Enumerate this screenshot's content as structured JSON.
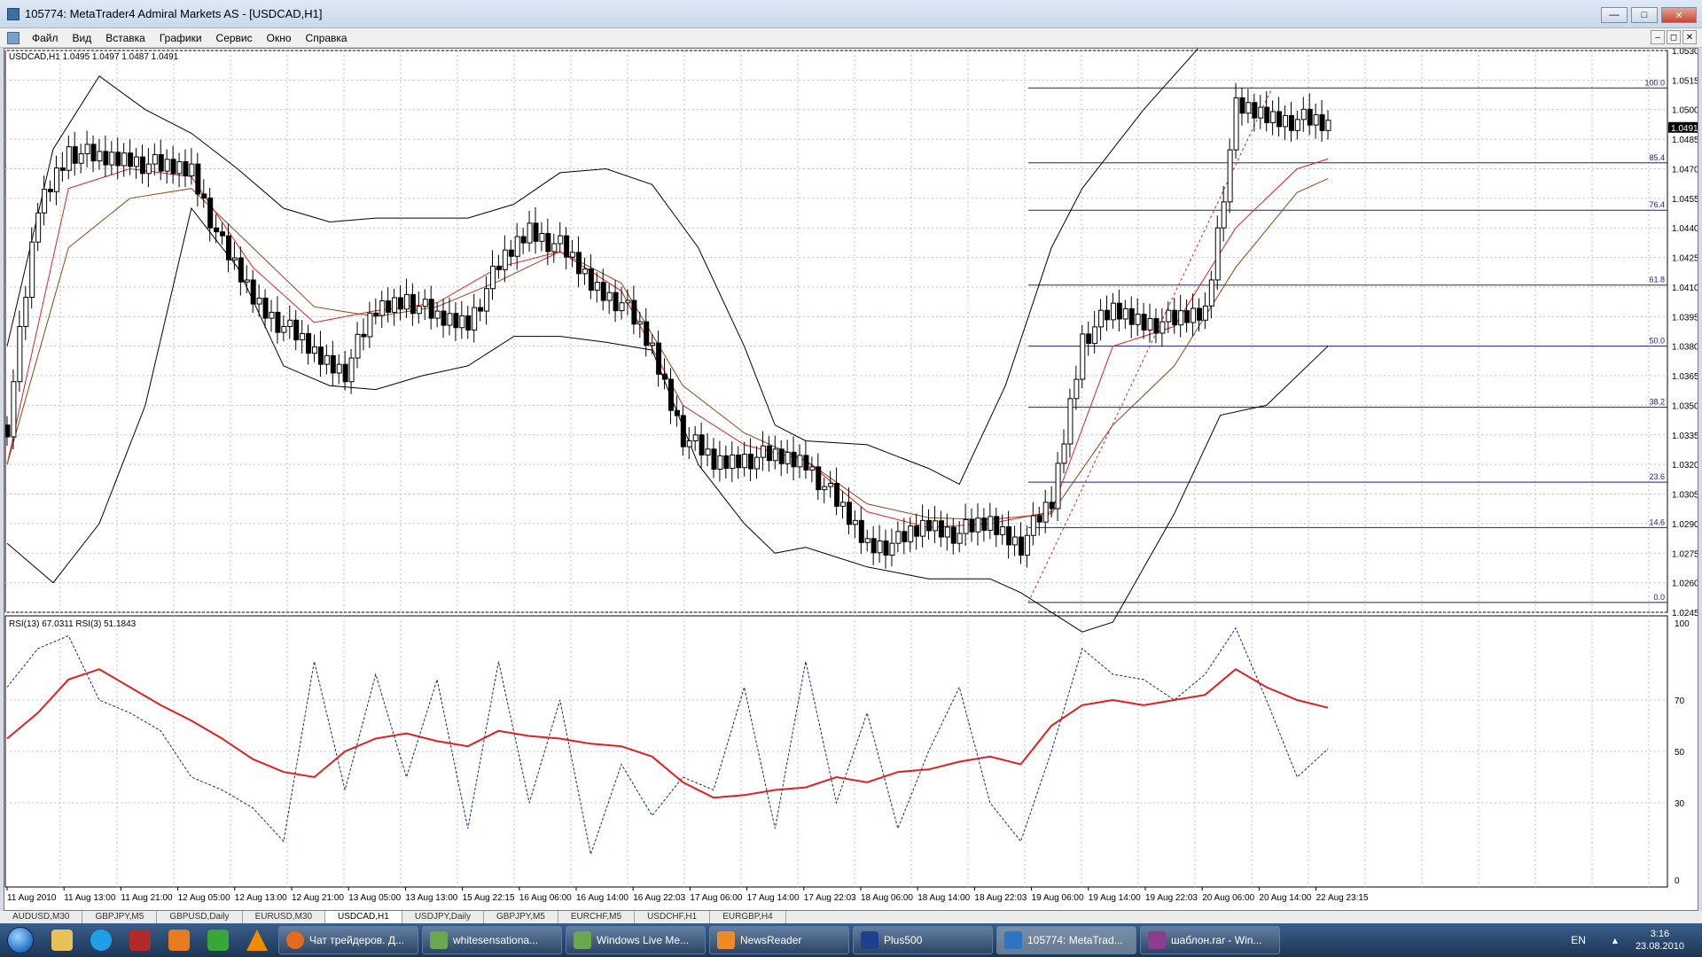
{
  "window": {
    "title": "105774: MetaTrader4 Admiral Markets AS - [USDCAD,H1]",
    "min_label": "—",
    "max_label": "□",
    "close_label": "✕"
  },
  "menu": {
    "items": [
      "Файл",
      "Вид",
      "Вставка",
      "Графики",
      "Сервис",
      "Окно",
      "Справка"
    ],
    "mdi": [
      "–",
      "◻",
      "✕"
    ]
  },
  "chart": {
    "header": "USDCAD,H1  1.0495 1.0497 1.0487 1.0491",
    "price_axis": [
      "1.0530",
      "1.0515",
      "1.0500",
      "1.0485",
      "1.0470",
      "1.0455",
      "1.0440",
      "1.0425",
      "1.0410",
      "1.0395",
      "1.0380",
      "1.0365",
      "1.0350",
      "1.0335",
      "1.0320",
      "1.0305",
      "1.0290",
      "1.0275",
      "1.0260",
      "1.0245"
    ],
    "current_price": "1.0491",
    "fib_levels": [
      {
        "label": "100.0",
        "price": 1.0511
      },
      {
        "label": "85.4",
        "price": 1.0473
      },
      {
        "label": "76.4",
        "price": 1.0449
      },
      {
        "label": "61.8",
        "price": 1.0411
      },
      {
        "label": "50.0",
        "price": 1.038
      },
      {
        "label": "38.2",
        "price": 1.0349
      },
      {
        "label": "23.6",
        "price": 1.0311
      },
      {
        "label": "14.6",
        "price": 1.0288
      },
      {
        "label": "0.0",
        "price": 1.025
      }
    ],
    "time_axis": [
      "11 Aug 2010",
      "11 Aug 13:00",
      "11 Aug 21:00",
      "12 Aug 05:00",
      "12 Aug 13:00",
      "12 Aug 21:00",
      "13 Aug 05:00",
      "13 Aug 13:00",
      "15 Aug 22:15",
      "16 Aug 06:00",
      "16 Aug 14:00",
      "16 Aug 22:03",
      "17 Aug 06:00",
      "17 Aug 14:00",
      "17 Aug 22:03",
      "18 Aug 06:00",
      "18 Aug 14:00",
      "18 Aug 22:03",
      "19 Aug 06:00",
      "19 Aug 14:00",
      "19 Aug 22:03",
      "20 Aug 06:00",
      "20 Aug 14:00",
      "22 Aug 23:15"
    ],
    "rsi_header": "RSI(13) 67.0311  RSI(3) 51.1843",
    "rsi_axis": [
      "100",
      "70",
      "50",
      "30",
      "0"
    ]
  },
  "chart_data": {
    "type": "line",
    "symbol": "USDCAD",
    "timeframe": "H1",
    "ylim": [
      1.0245,
      1.053
    ],
    "close_path": [
      [
        0,
        1.034
      ],
      [
        20,
        1.045
      ],
      [
        40,
        1.048
      ],
      [
        60,
        1.0474
      ],
      [
        80,
        1.0476
      ],
      [
        100,
        1.047
      ],
      [
        120,
        1.047
      ],
      [
        140,
        1.043
      ],
      [
        160,
        1.0405
      ],
      [
        180,
        1.039
      ],
      [
        200,
        1.0376
      ],
      [
        220,
        1.0368
      ],
      [
        240,
        1.0398
      ],
      [
        260,
        1.0405
      ],
      [
        280,
        1.0393
      ],
      [
        300,
        1.0393
      ],
      [
        320,
        1.042
      ],
      [
        340,
        1.044
      ],
      [
        360,
        1.043
      ],
      [
        380,
        1.0412
      ],
      [
        400,
        1.0402
      ],
      [
        420,
        1.0378
      ],
      [
        440,
        1.0335
      ],
      [
        460,
        1.032
      ],
      [
        480,
        1.0324
      ],
      [
        500,
        1.0323
      ],
      [
        520,
        1.0322
      ],
      [
        540,
        1.03
      ],
      [
        560,
        1.028
      ],
      [
        580,
        1.028
      ],
      [
        600,
        1.029
      ],
      [
        620,
        1.0285
      ],
      [
        640,
        1.029
      ],
      [
        660,
        1.028
      ],
      [
        680,
        1.03
      ],
      [
        700,
        1.0385
      ],
      [
        720,
        1.0397
      ],
      [
        740,
        1.0393
      ],
      [
        760,
        1.0392
      ],
      [
        780,
        1.0398
      ],
      [
        800,
        1.05
      ],
      [
        820,
        1.0497
      ],
      [
        840,
        1.0495
      ],
      [
        860,
        1.0491
      ]
    ],
    "ema_fast": [
      [
        0,
        1.032
      ],
      [
        40,
        1.046
      ],
      [
        80,
        1.047
      ],
      [
        120,
        1.0466
      ],
      [
        160,
        1.042
      ],
      [
        200,
        1.0392
      ],
      [
        240,
        1.0398
      ],
      [
        280,
        1.0402
      ],
      [
        320,
        1.042
      ],
      [
        360,
        1.0428
      ],
      [
        400,
        1.0408
      ],
      [
        440,
        1.035
      ],
      [
        480,
        1.033
      ],
      [
        520,
        1.0322
      ],
      [
        560,
        1.0296
      ],
      [
        600,
        1.0288
      ],
      [
        640,
        1.029
      ],
      [
        680,
        1.0296
      ],
      [
        720,
        1.038
      ],
      [
        760,
        1.039
      ],
      [
        800,
        1.044
      ],
      [
        840,
        1.047
      ],
      [
        860,
        1.0475
      ]
    ],
    "ema_slow": [
      [
        0,
        1.032
      ],
      [
        40,
        1.043
      ],
      [
        80,
        1.0455
      ],
      [
        120,
        1.046
      ],
      [
        160,
        1.043
      ],
      [
        200,
        1.04
      ],
      [
        240,
        1.0395
      ],
      [
        280,
        1.04
      ],
      [
        320,
        1.0413
      ],
      [
        360,
        1.0428
      ],
      [
        400,
        1.0412
      ],
      [
        440,
        1.036
      ],
      [
        480,
        1.0336
      ],
      [
        520,
        1.0322
      ],
      [
        560,
        1.03
      ],
      [
        600,
        1.0293
      ],
      [
        640,
        1.0292
      ],
      [
        680,
        1.0295
      ],
      [
        720,
        1.034
      ],
      [
        760,
        1.037
      ],
      [
        800,
        1.042
      ],
      [
        840,
        1.0458
      ],
      [
        860,
        1.0465
      ]
    ],
    "bb_upper": [
      [
        0,
        1.038
      ],
      [
        30,
        1.048
      ],
      [
        60,
        1.0517
      ],
      [
        90,
        1.05
      ],
      [
        120,
        1.0488
      ],
      [
        150,
        1.047
      ],
      [
        180,
        1.045
      ],
      [
        210,
        1.0443
      ],
      [
        240,
        1.0445
      ],
      [
        270,
        1.0445
      ],
      [
        300,
        1.0445
      ],
      [
        330,
        1.0452
      ],
      [
        360,
        1.0468
      ],
      [
        390,
        1.047
      ],
      [
        420,
        1.0462
      ],
      [
        450,
        1.043
      ],
      [
        480,
        1.038
      ],
      [
        500,
        1.034
      ],
      [
        520,
        1.0332
      ],
      [
        560,
        1.033
      ],
      [
        600,
        1.0318
      ],
      [
        620,
        1.031
      ],
      [
        650,
        1.036
      ],
      [
        680,
        1.043
      ],
      [
        700,
        1.046
      ],
      [
        740,
        1.05
      ],
      [
        780,
        1.0535
      ]
    ],
    "bb_lower": [
      [
        0,
        1.028
      ],
      [
        30,
        1.026
      ],
      [
        60,
        1.029
      ],
      [
        90,
        1.035
      ],
      [
        120,
        1.045
      ],
      [
        150,
        1.042
      ],
      [
        180,
        1.037
      ],
      [
        210,
        1.036
      ],
      [
        240,
        1.0358
      ],
      [
        270,
        1.0365
      ],
      [
        300,
        1.037
      ],
      [
        330,
        1.0385
      ],
      [
        360,
        1.0385
      ],
      [
        390,
        1.0382
      ],
      [
        420,
        1.0378
      ],
      [
        450,
        1.032
      ],
      [
        480,
        1.029
      ],
      [
        500,
        1.0275
      ],
      [
        520,
        1.0278
      ],
      [
        560,
        1.0268
      ],
      [
        600,
        1.0262
      ],
      [
        640,
        1.0262
      ],
      [
        660,
        1.0255
      ],
      [
        700,
        1.0235
      ],
      [
        720,
        1.024
      ],
      [
        760,
        1.0295
      ],
      [
        790,
        1.0345
      ],
      [
        820,
        1.035
      ],
      [
        860,
        1.038
      ]
    ],
    "rsi13": [
      [
        0,
        55
      ],
      [
        20,
        65
      ],
      [
        40,
        78
      ],
      [
        60,
        82
      ],
      [
        80,
        75
      ],
      [
        100,
        68
      ],
      [
        120,
        62
      ],
      [
        140,
        55
      ],
      [
        160,
        47
      ],
      [
        180,
        42
      ],
      [
        200,
        40
      ],
      [
        220,
        50
      ],
      [
        240,
        55
      ],
      [
        260,
        57
      ],
      [
        280,
        54
      ],
      [
        300,
        52
      ],
      [
        320,
        58
      ],
      [
        340,
        56
      ],
      [
        360,
        55
      ],
      [
        380,
        53
      ],
      [
        400,
        52
      ],
      [
        420,
        48
      ],
      [
        440,
        38
      ],
      [
        460,
        32
      ],
      [
        480,
        33
      ],
      [
        500,
        35
      ],
      [
        520,
        36
      ],
      [
        540,
        40
      ],
      [
        560,
        38
      ],
      [
        580,
        42
      ],
      [
        600,
        43
      ],
      [
        620,
        46
      ],
      [
        640,
        48
      ],
      [
        660,
        45
      ],
      [
        680,
        60
      ],
      [
        700,
        68
      ],
      [
        720,
        70
      ],
      [
        740,
        68
      ],
      [
        760,
        70
      ],
      [
        780,
        72
      ],
      [
        800,
        82
      ],
      [
        820,
        75
      ],
      [
        840,
        70
      ],
      [
        860,
        67
      ]
    ],
    "rsi3": [
      [
        0,
        75
      ],
      [
        20,
        90
      ],
      [
        40,
        95
      ],
      [
        60,
        70
      ],
      [
        80,
        65
      ],
      [
        100,
        58
      ],
      [
        120,
        40
      ],
      [
        140,
        35
      ],
      [
        160,
        28
      ],
      [
        180,
        15
      ],
      [
        200,
        85
      ],
      [
        220,
        35
      ],
      [
        240,
        80
      ],
      [
        260,
        40
      ],
      [
        280,
        78
      ],
      [
        300,
        20
      ],
      [
        320,
        85
      ],
      [
        340,
        30
      ],
      [
        360,
        70
      ],
      [
        380,
        10
      ],
      [
        400,
        45
      ],
      [
        420,
        25
      ],
      [
        440,
        40
      ],
      [
        460,
        35
      ],
      [
        480,
        75
      ],
      [
        500,
        20
      ],
      [
        520,
        85
      ],
      [
        540,
        30
      ],
      [
        560,
        65
      ],
      [
        580,
        20
      ],
      [
        600,
        50
      ],
      [
        620,
        75
      ],
      [
        640,
        30
      ],
      [
        660,
        15
      ],
      [
        680,
        50
      ],
      [
        700,
        90
      ],
      [
        720,
        80
      ],
      [
        740,
        78
      ],
      [
        760,
        70
      ],
      [
        780,
        80
      ],
      [
        800,
        98
      ],
      [
        820,
        70
      ],
      [
        840,
        40
      ],
      [
        860,
        51
      ]
    ],
    "rsi_ylim": [
      0,
      100
    ]
  },
  "symbol_tabs": [
    "AUDUSD,M30",
    "GBPJPY,M5",
    "GBPUSD,Daily",
    "EURUSD,M30",
    "USDCAD,H1",
    "USDJPY,Daily",
    "GBPJPY,M5",
    "EURCHF,M5",
    "USDCHF,H1",
    "EURGBP,H4"
  ],
  "active_tab": 4,
  "taskbar": {
    "tasks": [
      {
        "label": "Чат трейдеров. Д...",
        "color": "#e46a1f"
      },
      {
        "label": "whitesensationa...",
        "color": "#6aa84f"
      },
      {
        "label": "Windows Live Me...",
        "color": "#6aa84f"
      },
      {
        "label": "NewsReader",
        "color": "#f08a24"
      },
      {
        "label": "Plus500",
        "color": "#1f3f8f"
      },
      {
        "label": "105774: MetaTrad...",
        "color": "#2f74c0"
      },
      {
        "label": "шаблон.rar - Win...",
        "color": "#8e3a8f"
      }
    ],
    "lang": "EN",
    "time": "3:16",
    "date": "23.08.2010"
  }
}
